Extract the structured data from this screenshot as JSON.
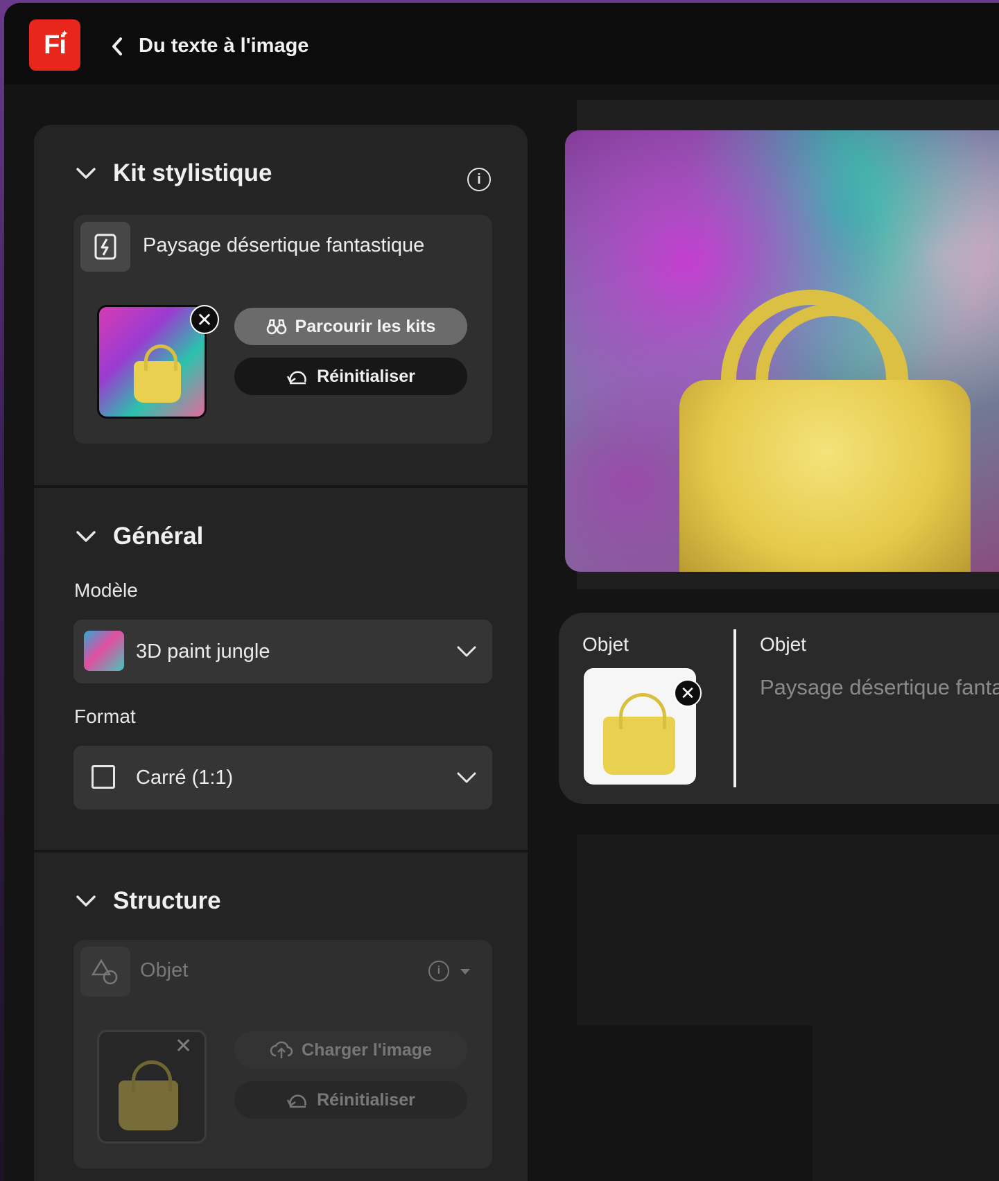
{
  "header": {
    "app_logo": "Fi",
    "title": "Du texte à l'image"
  },
  "style_kit": {
    "title": "Kit stylistique",
    "kit_name": "Paysage désertique fantastique",
    "browse_label": "Parcourir les kits",
    "reset_label": "Réinitialiser"
  },
  "general": {
    "title": "Général",
    "model_label": "Modèle",
    "model_value": "3D paint jungle",
    "format_label": "Format",
    "format_value": "Carré (1:1)"
  },
  "structure": {
    "title": "Structure",
    "type_value": "Objet",
    "upload_label": "Charger l'image",
    "reset_label": "Réinitialiser"
  },
  "object_panel": {
    "left_label": "Objet",
    "right_label": "Objet",
    "description": "Paysage désertique fantas"
  },
  "icons": {
    "back": "chevron-left-icon",
    "collapse": "chevron-down-icon",
    "info": "info-icon",
    "kit": "lightning-kit-icon",
    "browse": "binoculars-icon",
    "reset": "undo-icon",
    "remove": "close-icon",
    "square": "square-icon",
    "shapes": "shapes-icon",
    "upload": "cloud-upload-icon"
  },
  "colors": {
    "brand": "#e8261c",
    "panel": "#242424",
    "card": "#2f2f2f",
    "bag": "#e6c94a"
  }
}
